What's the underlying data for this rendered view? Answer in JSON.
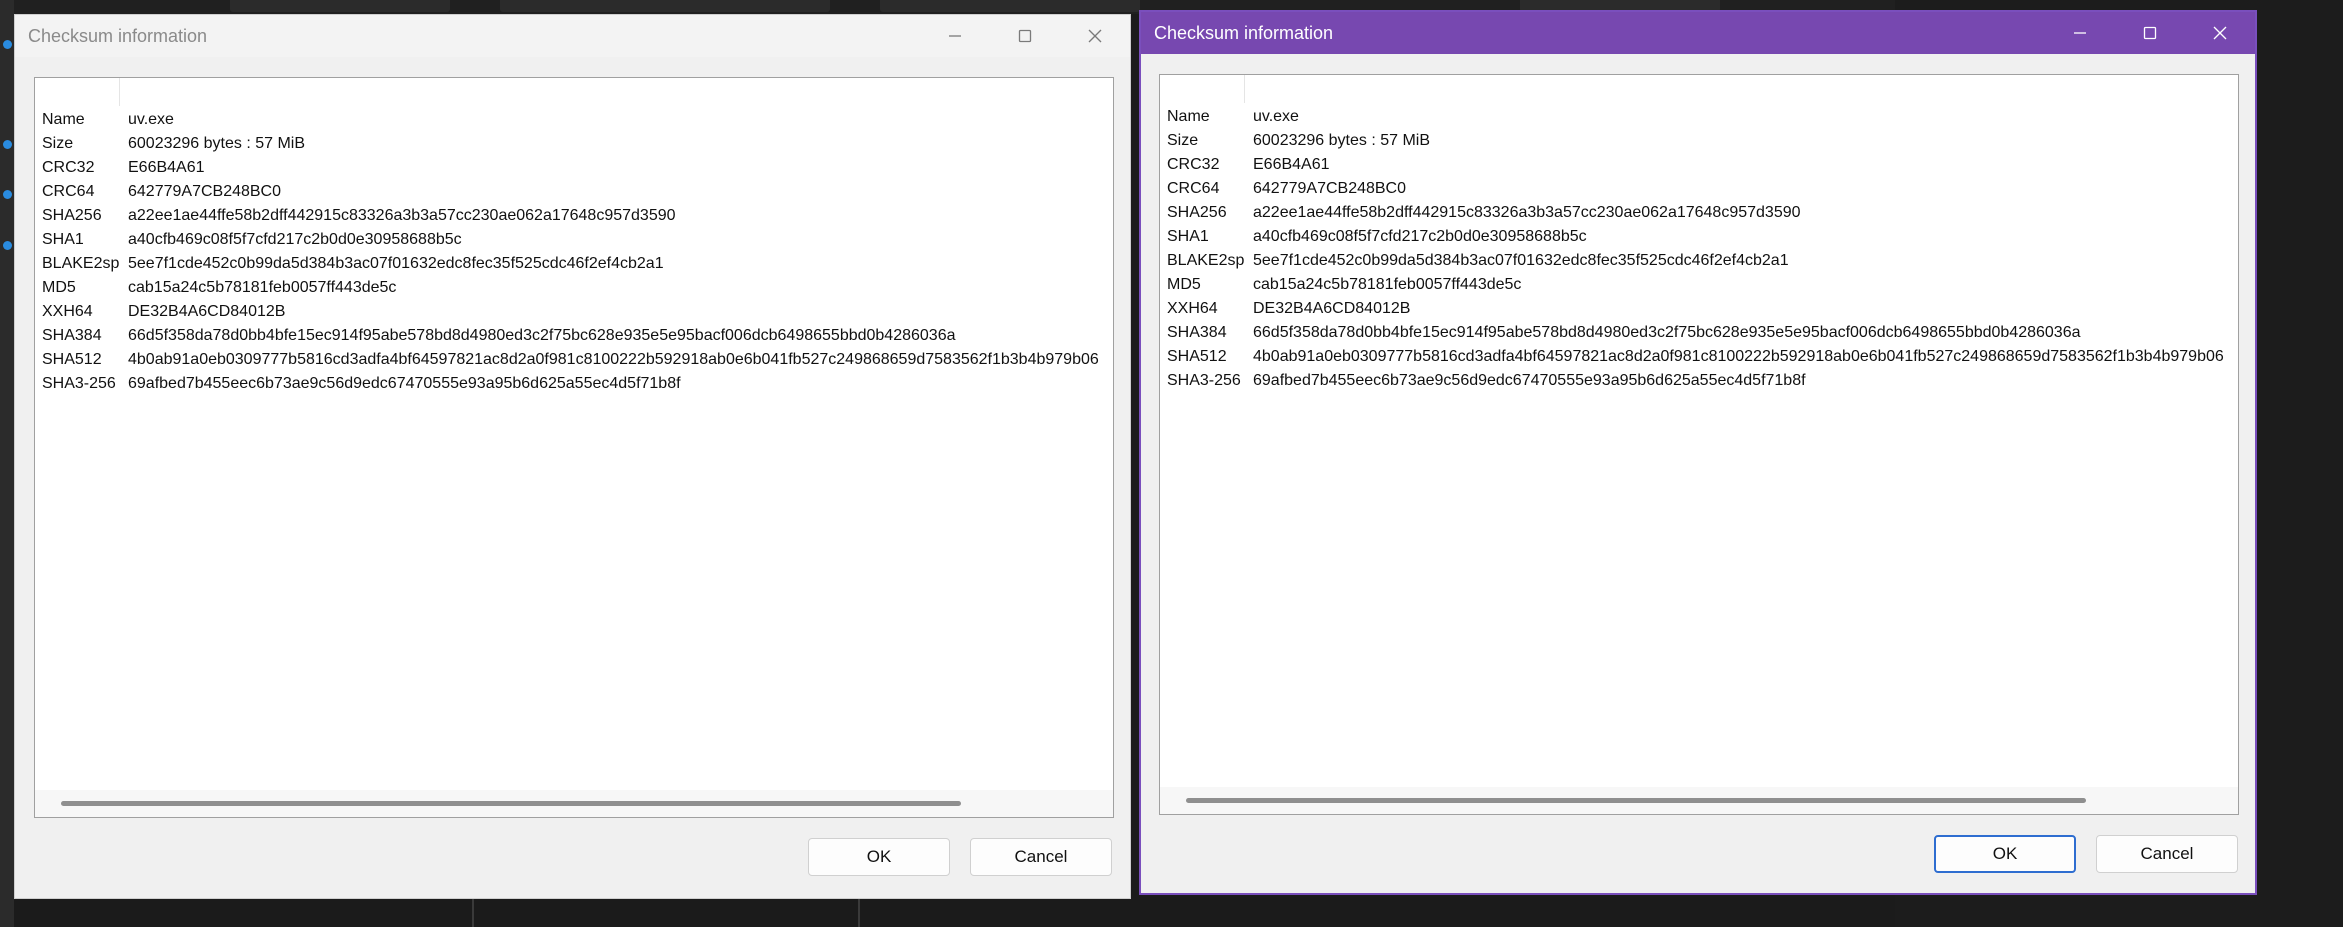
{
  "title": "Checksum information",
  "rows": [
    {
      "key": "Name",
      "value": "uv.exe"
    },
    {
      "key": "Size",
      "value": "60023296 bytes : 57 MiB"
    },
    {
      "key": "CRC32",
      "value": "E66B4A61"
    },
    {
      "key": "CRC64",
      "value": "642779A7CB248BC0"
    },
    {
      "key": "SHA256",
      "value": "a22ee1ae44ffe58b2dff442915c83326a3b3a57cc230ae062a17648c957d3590"
    },
    {
      "key": "SHA1",
      "value": "a40cfb469c08f5f7cfd217c2b0d0e30958688b5c"
    },
    {
      "key": "BLAKE2sp",
      "value": "5ee7f1cde452c0b99da5d384b3ac07f01632edc8fec35f525cdc46f2ef4cb2a1"
    },
    {
      "key": "MD5",
      "value": "cab15a24c5b78181feb0057ff443de5c"
    },
    {
      "key": "XXH64",
      "value": "DE32B4A6CD84012B"
    },
    {
      "key": "SHA384",
      "value": "66d5f358da78d0bb4bfe15ec914f95abe578bd8d4980ed3c2f75bc628e935e5e95bacf006dcb6498655bbd0b4286036a"
    },
    {
      "key": "SHA512",
      "value": "4b0ab91a0eb0309777b5816cd3adfa4bf64597821ac8d2a0f981c8100222b592918ab0e6b041fb527c249868659d7583562f1b3b4b979b06"
    },
    {
      "key": "SHA3-256",
      "value": "69afbed7b455eec6b73ae9c56d9edc67470555e93a95b6d625a55ec4d5f71b8f"
    }
  ],
  "buttons": {
    "ok": "OK",
    "cancel": "Cancel"
  },
  "colors": {
    "active_titlebar": "#7748b0",
    "active_border": "#7a4fbd",
    "ok_focus": "#2e6dd0"
  }
}
